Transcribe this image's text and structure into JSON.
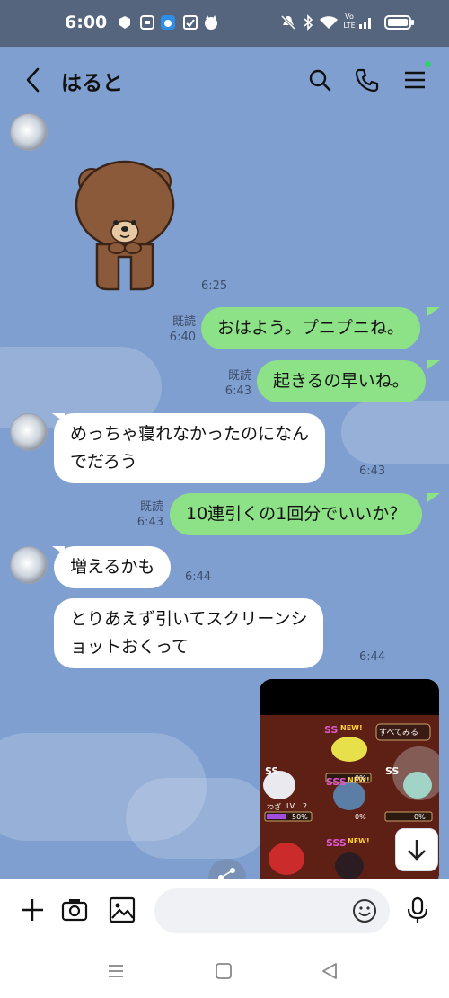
{
  "status_bar": {
    "time": "6:00",
    "network_label_top": "Vo",
    "network_label_bottom": "LTE"
  },
  "header": {
    "contact_name": "はると",
    "icons": [
      "back-chevron-icon",
      "search-icon",
      "phone-icon",
      "menu-icon"
    ],
    "notification_dot_color": "#2fd16a"
  },
  "messages": [
    {
      "side": "in",
      "type": "sticker",
      "sticker": "brown-bear-bowing",
      "time": "6:25"
    },
    {
      "side": "out",
      "text": "おはよう。プニプニね。",
      "read": "既読",
      "time": "6:40"
    },
    {
      "side": "out",
      "text": "起きるの早いね。",
      "read": "既読",
      "time": "6:43"
    },
    {
      "side": "in",
      "lines": [
        "めっちゃ寝れなかったのになん",
        "でだろう"
      ],
      "time": "6:43"
    },
    {
      "side": "out",
      "text": "10連引くの1回分でいいか？",
      "read": "既読",
      "time": "6:43"
    },
    {
      "side": "in",
      "text": "増えるかも",
      "time": "6:44"
    },
    {
      "side": "in",
      "lines": [
        "とりあえず引いてスクリーンシ",
        "ョットおくって"
      ],
      "time": "6:44"
    },
    {
      "side": "out",
      "type": "image",
      "description_labels": {
        "banner": "すべてみる",
        "tags": [
          "SS",
          "NEW!",
          "SS",
          "SSS",
          "NEW!",
          "SS",
          "SSS",
          "NEW!"
        ],
        "lv_label": "LV",
        "lv_value": "2",
        "percent_a": "0%",
        "percent_b": "50%",
        "percent_c": "0%",
        "percent_d": "0%",
        "waza": "わざ"
      }
    }
  ],
  "input_bar": {
    "placeholder": "",
    "icons": [
      "plus-icon",
      "camera-icon",
      "image-icon",
      "emoji-icon",
      "microphone-icon"
    ]
  },
  "nav_bar": {
    "icons": [
      "recent-apps-icon",
      "home-icon",
      "back-triangle-icon"
    ]
  },
  "colors": {
    "chat_background": "#7f9fd0",
    "status_bar": "#56657e",
    "incoming_bubble": "#ffffff",
    "outgoing_bubble": "#8de186"
  }
}
